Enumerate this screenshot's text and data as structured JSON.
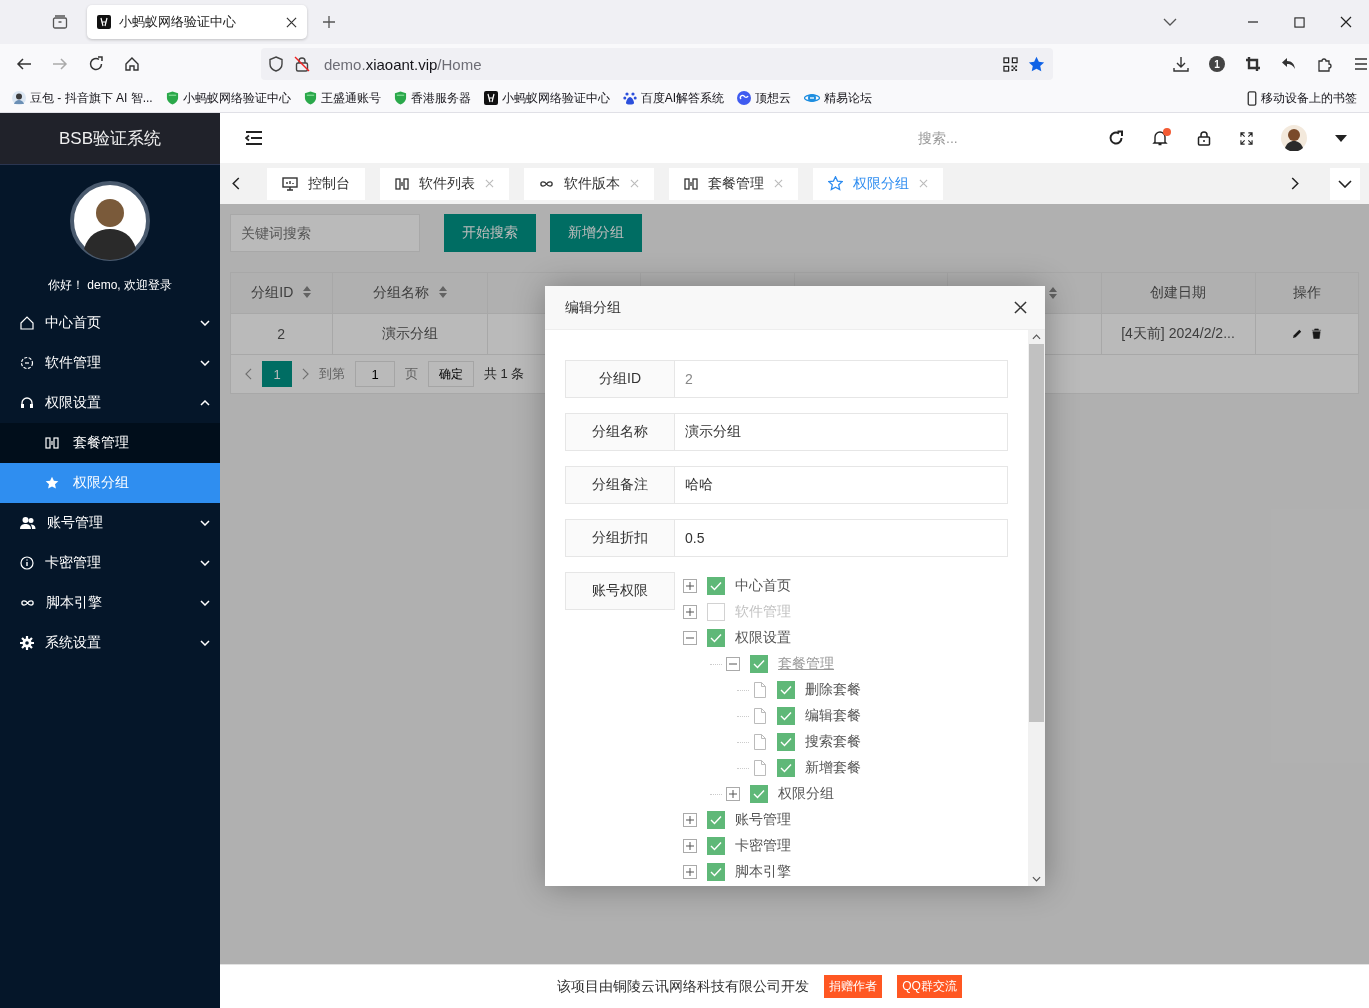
{
  "browser": {
    "tab_title": "小蚂蚁网络验证中心",
    "url": {
      "prefix": "demo.",
      "host": "xiaoant.vip",
      "path": "/Home"
    },
    "badge": "1",
    "bookmarks": [
      {
        "label": "豆包 - 抖音旗下 AI 智..."
      },
      {
        "label": "小蚂蚁网络验证中心"
      },
      {
        "label": "王盛通账号"
      },
      {
        "label": "香港服务器"
      },
      {
        "label": "小蚂蚁网络验证中心"
      },
      {
        "label": "百度AI解答系统"
      },
      {
        "label": "顶想云"
      },
      {
        "label": "精易论坛"
      }
    ],
    "mobile_bookmarks": "移动设备上的书签"
  },
  "sidebar": {
    "brand": "BSB验证系统",
    "greeting": "你好！ demo, 欢迎登录",
    "items": [
      {
        "label": "中心首页",
        "expanded": false
      },
      {
        "label": "软件管理",
        "expanded": false
      },
      {
        "label": "权限设置",
        "expanded": true,
        "children": [
          {
            "label": "套餐管理",
            "selected": false
          },
          {
            "label": "权限分组",
            "selected": true
          }
        ]
      },
      {
        "label": "账号管理",
        "expanded": false
      },
      {
        "label": "卡密管理",
        "expanded": false
      },
      {
        "label": "脚本引擎",
        "expanded": false
      },
      {
        "label": "系统设置",
        "expanded": false
      }
    ]
  },
  "header": {
    "search": {
      "placeholder": "搜索..."
    },
    "notification_dot": true
  },
  "tabs": [
    {
      "label": "控制台",
      "closable": false,
      "selected": false
    },
    {
      "label": "软件列表",
      "closable": true,
      "selected": false
    },
    {
      "label": "软件版本",
      "closable": true,
      "selected": false
    },
    {
      "label": "套餐管理",
      "closable": true,
      "selected": false
    },
    {
      "label": "权限分组",
      "closable": true,
      "selected": true
    }
  ],
  "toolbar": {
    "search": {
      "placeholder": "关键词搜索"
    },
    "buttons": [
      "开始搜索",
      "新增分组"
    ]
  },
  "table": {
    "columns": [
      {
        "label": "分组ID",
        "sortable": true
      },
      {
        "label": "分组名称",
        "sortable": true
      },
      {
        "sortable": true
      },
      {
        "label": "创建日期",
        "sortable": false
      },
      {
        "label": "操作",
        "sortable": false
      }
    ],
    "rows": [
      {
        "id": "2",
        "name": "演示分组",
        "created": "[4天前] 2024/2/2..."
      }
    ]
  },
  "pagination": {
    "pages": [
      {
        "label": "1",
        "selected": true
      }
    ],
    "goto_label": "到第",
    "goto_value": "1",
    "page_unit": "页",
    "confirm": "确定",
    "total": "共 1 条"
  },
  "modal": {
    "title": "编辑分组",
    "fields": [
      {
        "label": "分组ID",
        "value": "2",
        "disabled": true
      },
      {
        "label": "分组名称",
        "value": "演示分组",
        "disabled": false
      },
      {
        "label": "分组备注",
        "value": "哈哈",
        "disabled": false
      },
      {
        "label": "分组折扣",
        "value": "0.5",
        "disabled": false
      }
    ],
    "permissions_label": "账号权限",
    "permissions": [
      {
        "label": "中心首页",
        "kind": "branch",
        "expanded": false,
        "checked": true,
        "disabled": false,
        "hovered": false
      },
      {
        "label": "软件管理",
        "kind": "branch",
        "expanded": false,
        "checked": false,
        "disabled": true,
        "hovered": false
      },
      {
        "label": "权限设置",
        "kind": "branch",
        "expanded": true,
        "checked": true,
        "disabled": false,
        "hovered": false,
        "children": [
          {
            "label": "套餐管理",
            "kind": "branch",
            "expanded": true,
            "checked": true,
            "disabled": true,
            "hovered": true,
            "children": [
              {
                "label": "删除套餐",
                "kind": "leaf",
                "checked": true,
                "disabled": false,
                "hovered": false
              },
              {
                "label": "编辑套餐",
                "kind": "leaf",
                "checked": true,
                "disabled": false,
                "hovered": false
              },
              {
                "label": "搜索套餐",
                "kind": "leaf",
                "checked": true,
                "disabled": false,
                "hovered": false
              },
              {
                "label": "新增套餐",
                "kind": "leaf",
                "checked": true,
                "disabled": false,
                "hovered": false
              }
            ]
          },
          {
            "label": "权限分组",
            "kind": "branch",
            "expanded": false,
            "checked": true,
            "disabled": false,
            "hovered": false
          }
        ]
      },
      {
        "label": "账号管理",
        "kind": "branch",
        "expanded": false,
        "checked": true,
        "disabled": false,
        "hovered": false
      },
      {
        "label": "卡密管理",
        "kind": "branch",
        "expanded": false,
        "checked": true,
        "disabled": false,
        "hovered": false
      },
      {
        "label": "脚本引擎",
        "kind": "branch",
        "expanded": false,
        "checked": true,
        "disabled": false,
        "hovered": false
      }
    ]
  },
  "footer": {
    "text": "该项目由铜陵云讯网络科技有限公司开发",
    "links": [
      "捐赠作者",
      "QQ群交流"
    ]
  }
}
